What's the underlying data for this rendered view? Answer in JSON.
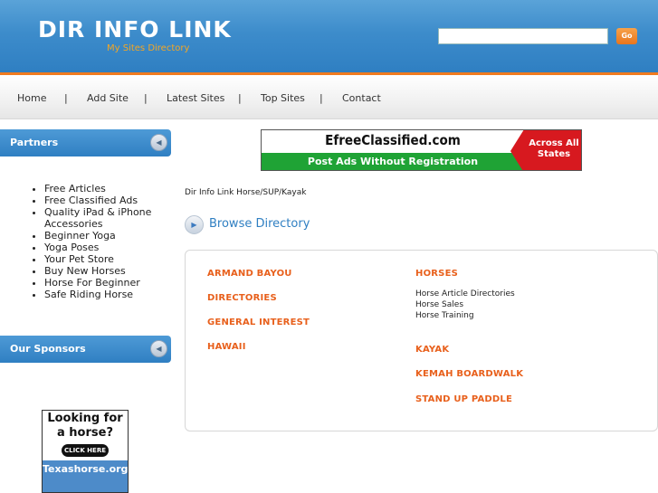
{
  "header": {
    "logo": "DIR INFO LINK",
    "tagline": "My Sites Directory",
    "search_value": "",
    "go_label": "Go"
  },
  "nav": {
    "items": [
      "Home",
      "Add Site",
      "Latest Sites",
      "Top Sites",
      "Contact"
    ],
    "separator": "|"
  },
  "sidebar": {
    "partners_title": "Partners",
    "partners": [
      "Free Articles",
      "Free Classified Ads",
      "Quality iPad & iPhone Accessories",
      "Beginner Yoga",
      "Yoga Poses",
      "Your Pet Store",
      "Buy New Horses",
      "Horse For Beginner",
      "Safe Riding Horse"
    ],
    "sponsors_title": "Our Sponsors",
    "sponsor_ad": {
      "headline": "Looking for a horse?",
      "button": "CLICK HERE",
      "site": "Texashorse.org"
    }
  },
  "banner": {
    "name": "EfreeClassified.com",
    "sub": "Post Ads Without Registration",
    "badge": "Across All States",
    "colors": {
      "green": "#1fa335",
      "red": "#d7191f"
    }
  },
  "main": {
    "breadcrumb": "Dir Info Link Horse/SUP/Kayak",
    "browse_title": "Browse Directory",
    "left_categories": [
      "ARMAND BAYOU",
      "DIRECTORIES",
      "GENERAL INTEREST",
      "HAWAII"
    ],
    "right_categories": [
      {
        "name": "HORSES",
        "subs": [
          "Horse Article Directories",
          "Horse Sales",
          "Horse Training"
        ]
      },
      {
        "name": "KAYAK",
        "subs": []
      },
      {
        "name": "KEMAH BOARDWALK",
        "subs": []
      },
      {
        "name": "STAND UP PADDLE",
        "subs": []
      }
    ]
  },
  "colors": {
    "header_blue": "#2f7fc2",
    "accent_orange": "#f07b1f",
    "category_orange": "#e8601c"
  }
}
